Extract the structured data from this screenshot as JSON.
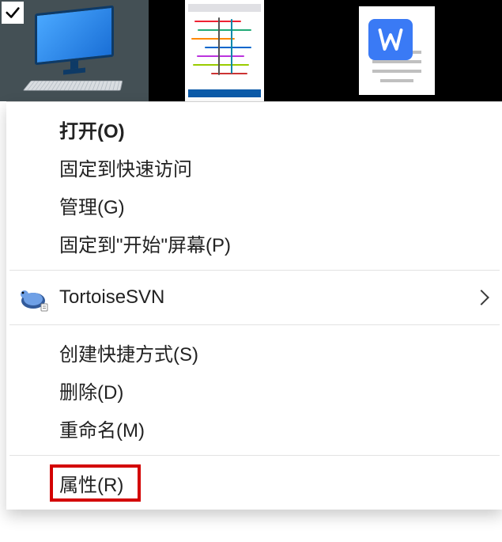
{
  "thumbnails": {
    "computer": {
      "selected": true
    },
    "image_file": {},
    "document": {}
  },
  "context_menu": {
    "sections": [
      {
        "items": [
          {
            "label": "打开(O)",
            "bold": true
          },
          {
            "label": "固定到快速访问"
          },
          {
            "label": "管理(G)"
          },
          {
            "label": "固定到\"开始\"屏幕(P)"
          }
        ]
      },
      {
        "items": [
          {
            "label": "TortoiseSVN",
            "icon": "tortoisesvn",
            "submenu": true
          }
        ]
      },
      {
        "items": [
          {
            "label": "创建快捷方式(S)"
          },
          {
            "label": "删除(D)"
          },
          {
            "label": "重命名(M)"
          }
        ]
      },
      {
        "items": [
          {
            "label": "属性(R)",
            "highlighted": true
          }
        ]
      }
    ]
  }
}
